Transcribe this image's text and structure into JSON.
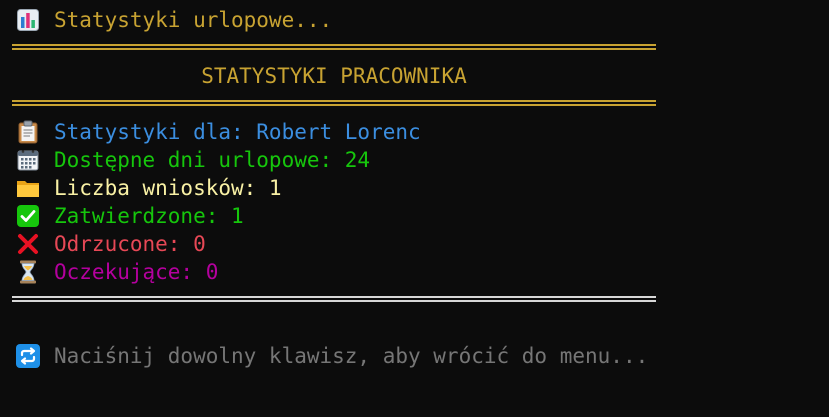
{
  "window": {
    "title": "Statystyki urlopowe..."
  },
  "header": {
    "heading": "STATYSTYKI PRACOWNIKA"
  },
  "stats": {
    "employee": "Statystyki dla: Robert Lorenc",
    "available_days": "Dostępne dni urlopowe: 24",
    "requests_count": "Liczba wniosków: 1",
    "approved": "Zatwierdzone: 1",
    "rejected": "Odrzucone: 0",
    "pending": "Oczekujące: 0"
  },
  "footer": {
    "prompt": "Naciśnij dowolny klawisz, aby wrócić do menu..."
  },
  "icons": {
    "title": "bar-chart-icon",
    "employee": "clipboard-icon",
    "available_days": "calendar-icon",
    "requests_count": "folder-icon",
    "approved": "check-mark-icon",
    "rejected": "cross-mark-icon",
    "pending": "hourglass-icon",
    "prompt": "repeat-icon"
  },
  "colors": {
    "background": "#0c0c0c",
    "gold": "#c8a332",
    "blue": "#3b8ee0",
    "green": "#16c60c",
    "yellow": "#f9f1a5",
    "red": "#e74856",
    "magenta": "#b4009e",
    "gray": "#767676",
    "white": "#d8d8d8"
  }
}
